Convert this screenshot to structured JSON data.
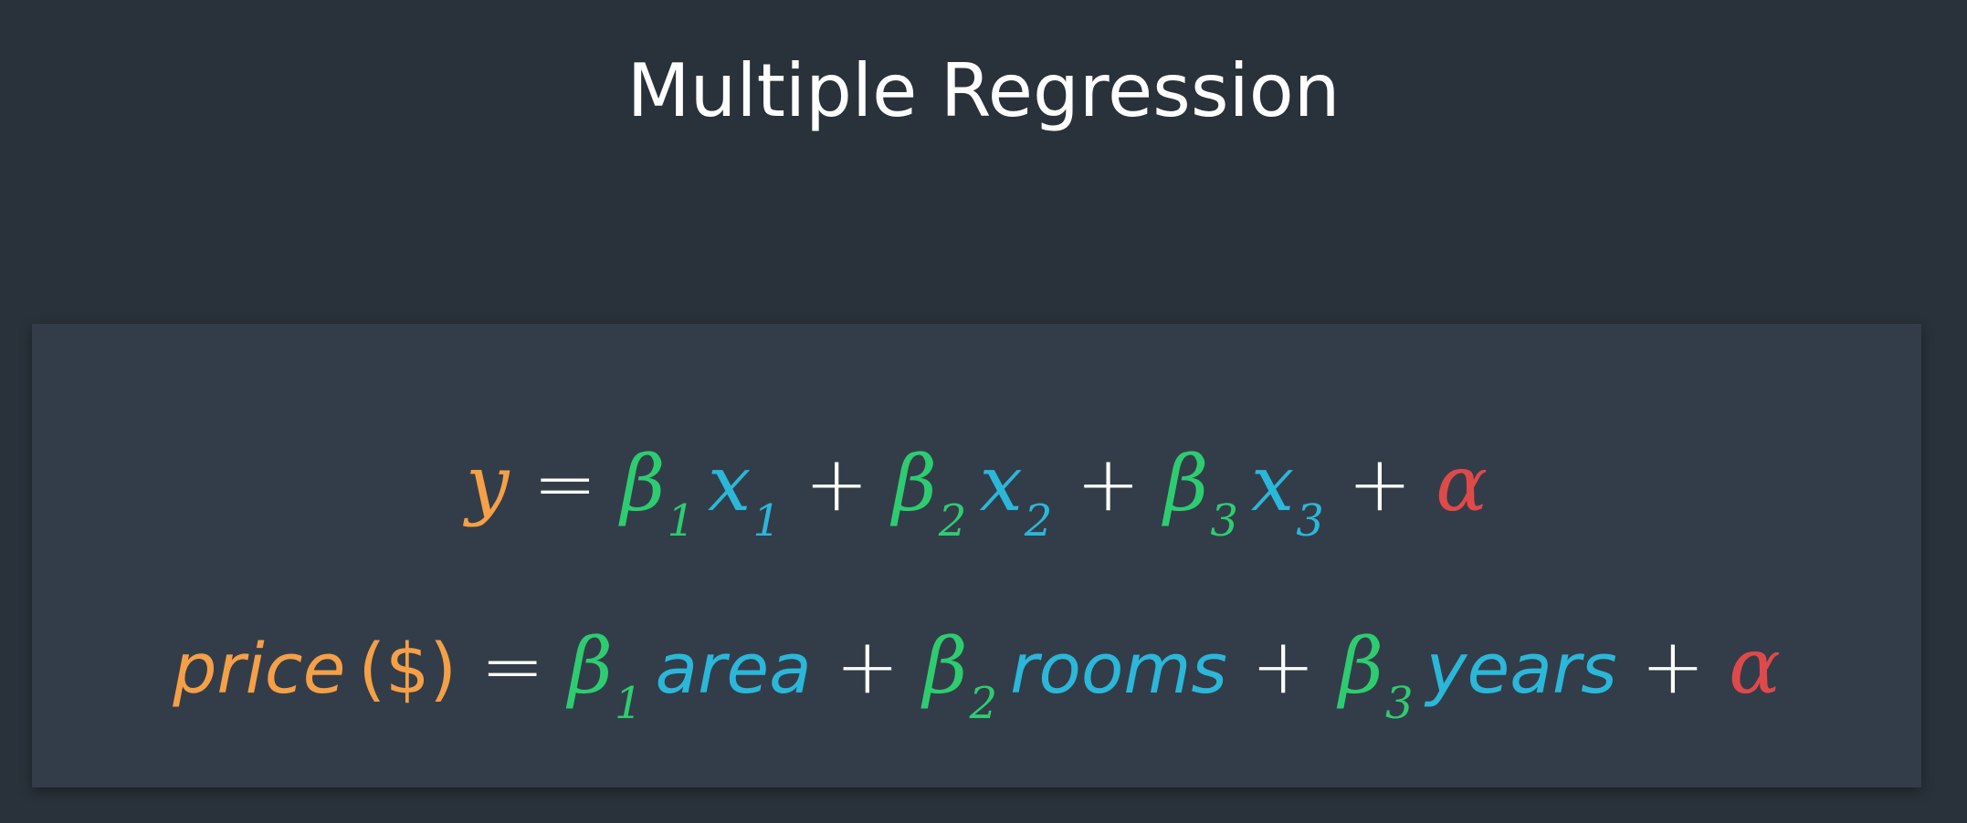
{
  "title": "Multiple Regression",
  "colors": {
    "background": "#29313a",
    "panel": "#333d49",
    "orange": "#f5a047",
    "green": "#2ecc71",
    "blue": "#2bb7d9",
    "red": "#e0494a",
    "white": "#ffffff"
  },
  "eq1": {
    "y": "y",
    "equals": "=",
    "beta": "β",
    "x": "x",
    "plus": "+",
    "alpha": "α",
    "sub1": "1",
    "sub2": "2",
    "sub3": "3"
  },
  "eq2": {
    "price": "price",
    "unit": "($)",
    "equals": "=",
    "beta": "β",
    "plus": "+",
    "alpha": "α",
    "sub1": "1",
    "sub2": "2",
    "sub3": "3",
    "var1": "area",
    "var2": "rooms",
    "var3": "years"
  }
}
